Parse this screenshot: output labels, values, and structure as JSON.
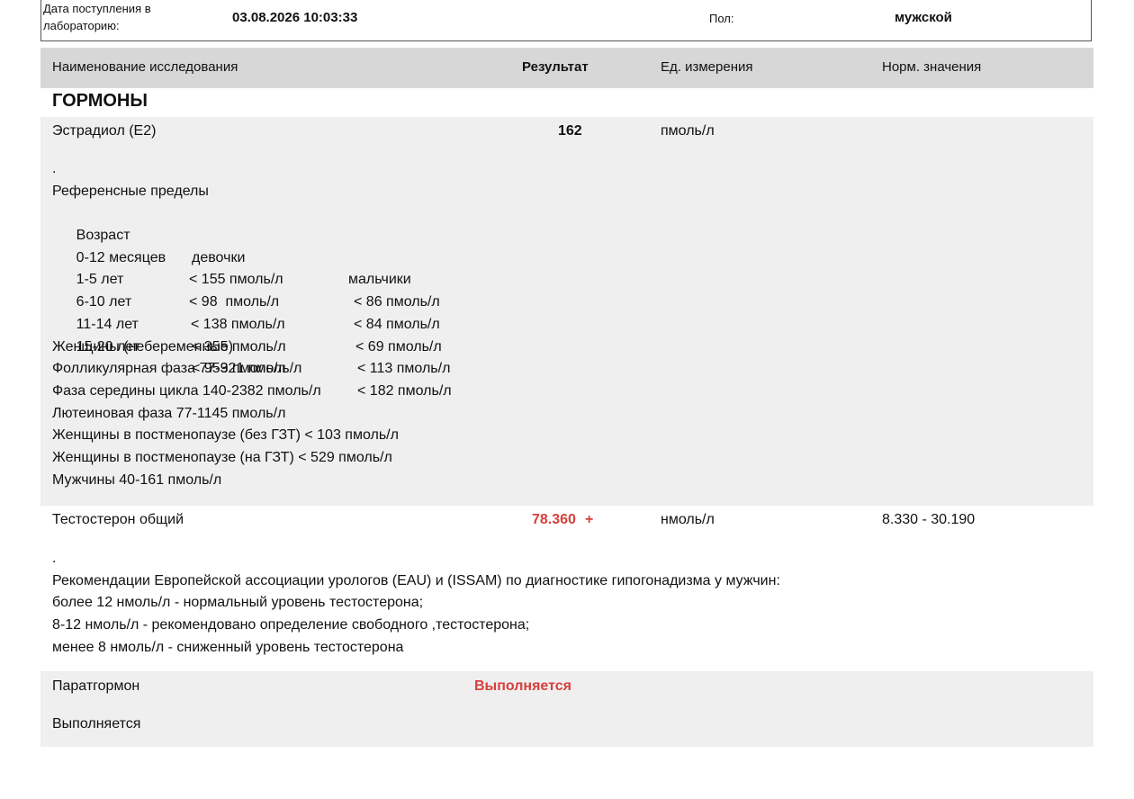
{
  "header": {
    "receive_label": "Дата поступления в лабораторию:",
    "receive_label_line1": "Дата поступления в",
    "receive_label_line2": "лабораторию:",
    "receive_value": "03.08.2026 10:03:33",
    "sex_label": "Пол:",
    "sex_value": "мужской"
  },
  "columns": {
    "name": "Наименование исследования",
    "result": "Результат",
    "unit": "Ед. измерения",
    "norm": "Норм. значения"
  },
  "section": "ГОРМОНЫ",
  "tests": [
    {
      "name": "Эстрадиол (E2)",
      "result": "162",
      "flag": "",
      "unit": "пмоль/л",
      "norm": "",
      "note": {
        "dot": ".",
        "title": "Референсные пределы",
        "age_table": {
          "headers": [
            "Возраст",
            "девочки",
            "мальчики"
          ],
          "rows": [
            [
              "0-12 месяцев",
              "< 155 пмоль/л",
              "< 86 пмоль/л"
            ],
            [
              "1-5 лет",
              "< 98  пмоль/л",
              "< 84 пмоль/л"
            ],
            [
              "6-10 лет",
              "< 138 пмоль/л",
              "< 69 пмоль/л"
            ],
            [
              "11-14 лет",
              "< 355 пмоль/л",
              "< 113 пмоль/л"
            ],
            [
              "15-20 лет",
              "< 953 пмоль/л",
              "< 182 пмоль/л"
            ]
          ]
        },
        "lines": [
          "Женщины (небеременные)",
          "Фолликулярная фаза 77-921 пмоль/л",
          "Фаза середины цикла 140-2382 пмоль/л",
          "Лютеиновая фаза 77-1145 пмоль/л",
          "Женщины в постменопаузе (без ГЗТ) < 103 пмоль/л",
          "Женщины в постменопаузе (на ГЗТ) < 529 пмоль/л",
          "Мужчины 40-161 пмоль/л"
        ]
      }
    },
    {
      "name": "Тестостерон общий",
      "result": "78.360",
      "flag": "+",
      "unit": "нмоль/л",
      "norm": "8.330 - 30.190",
      "note": {
        "dot": ".",
        "lines": [
          "Рекомендации Европейской ассоциации урологов (EAU) и (ISSAM) по диагностике гипогонадизма у мужчин:",
          "более 12 нмоль/л - нормальный уровень тестостерона;",
          "8-12 нмоль/л - рекомендовано определение свободного ,тестостерона;",
          "менее 8 нмоль/л - сниженный уровень тестостерона"
        ]
      }
    },
    {
      "name": "Паратгормон",
      "result": "Выполняется",
      "status_note": "Выполняется"
    }
  ],
  "colors": {
    "header_bg": "#d7d7d7",
    "row_bg": "#efefef",
    "flag_red": "#d7403c"
  }
}
